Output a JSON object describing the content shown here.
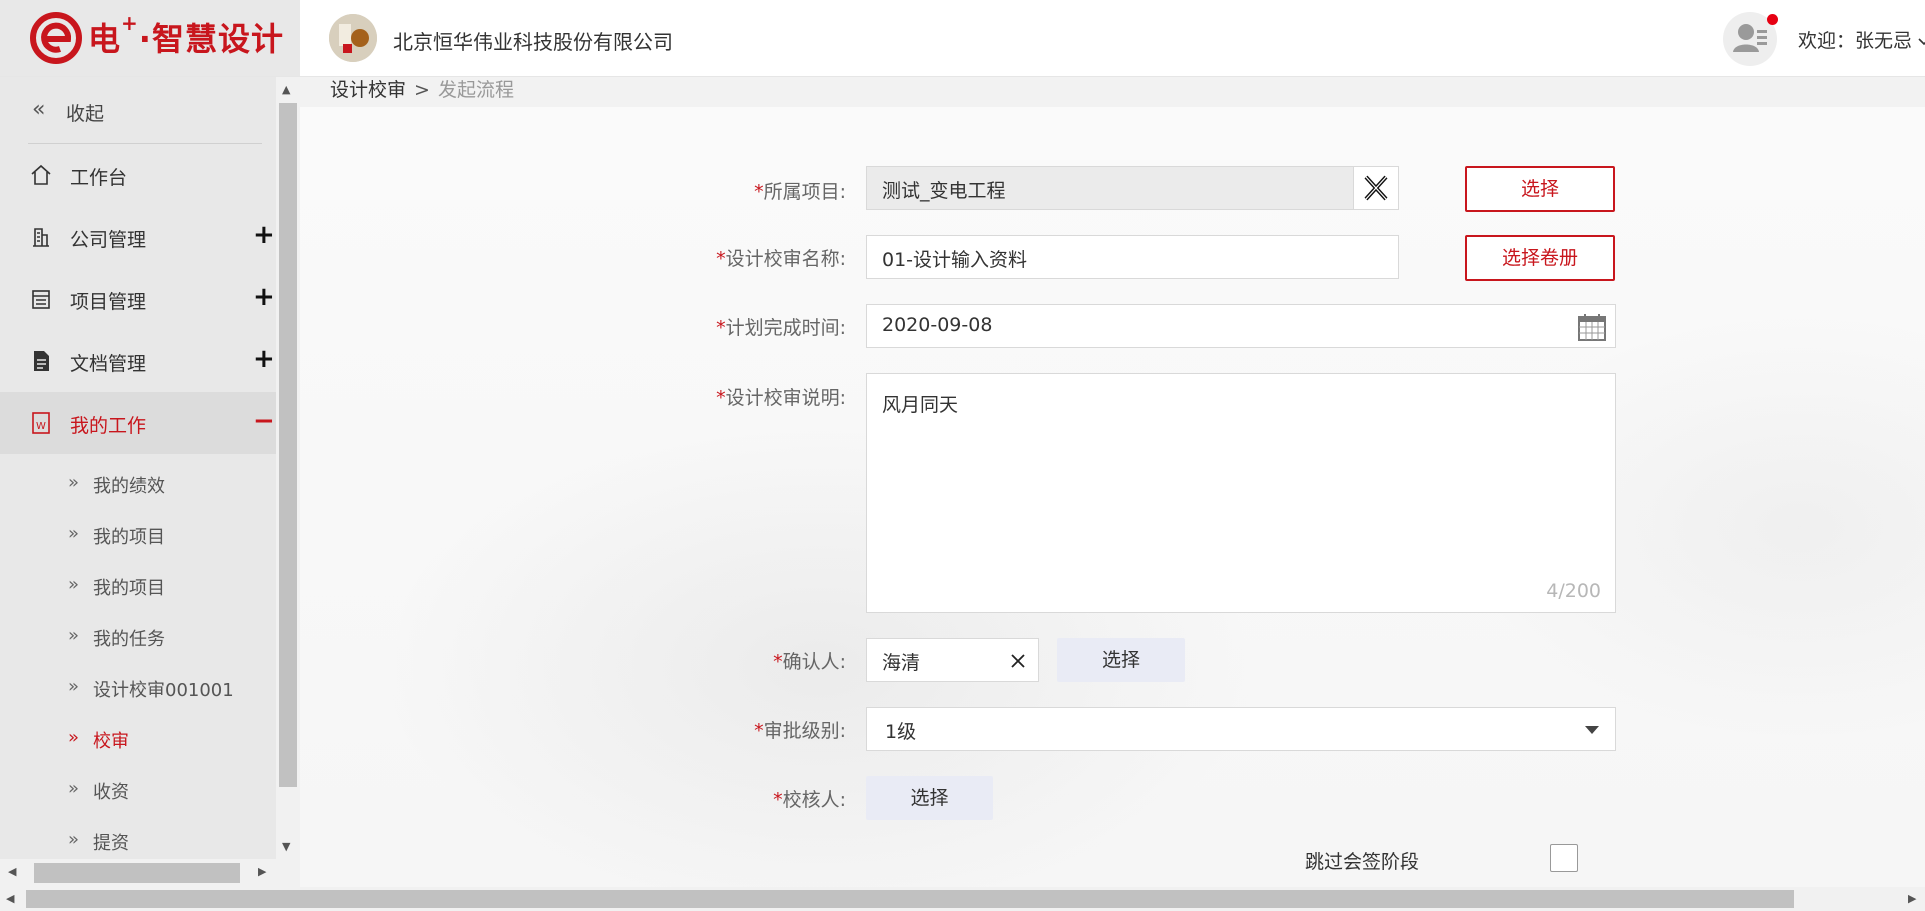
{
  "header": {
    "logo_text": "电",
    "logo_sup": "+",
    "logo_rest": "·智慧设计",
    "company_name": "北京恒华伟业科技股份有限公司",
    "welcome": "欢迎：张无忌"
  },
  "sidebar": {
    "collapse_label": "收起",
    "items": [
      {
        "label": "工作台",
        "icon": "home-icon",
        "toggle": ""
      },
      {
        "label": "公司管理",
        "icon": "building-icon",
        "toggle": "+"
      },
      {
        "label": "项目管理",
        "icon": "calendar-list-icon",
        "toggle": "+"
      },
      {
        "label": "文档管理",
        "icon": "document-icon",
        "toggle": "+"
      },
      {
        "label": "我的工作",
        "icon": "word-doc-icon",
        "toggle": "−"
      }
    ],
    "sub_items": [
      {
        "label": "我的绩效"
      },
      {
        "label": "我的项目"
      },
      {
        "label": "我的项目"
      },
      {
        "label": "我的任务"
      },
      {
        "label": "设计校审001001"
      },
      {
        "label": "校审"
      },
      {
        "label": "收资"
      },
      {
        "label": "提资"
      }
    ],
    "active_sub": "校审"
  },
  "breadcrumb": {
    "level1": "设计校审",
    "separator": ">",
    "level2": "发起流程"
  },
  "form": {
    "project": {
      "label": "所属项目:",
      "required": "*",
      "value": "测试_变电工程",
      "button": "选择"
    },
    "review_name": {
      "label": "设计校审名称:",
      "required": "*",
      "value": "01-设计输入资料",
      "button": "选择卷册"
    },
    "plan_date": {
      "label": "计划完成时间:",
      "required": "*",
      "value": "2020-09-08"
    },
    "description": {
      "label": "设计校审说明:",
      "required": "*",
      "value": "风月同天",
      "counter": "4/200"
    },
    "confirmer": {
      "label": "确认人:",
      "required": "*",
      "value": "海清",
      "button": "选择"
    },
    "approval_level": {
      "label": "审批级别:",
      "required": "*",
      "value": "1级"
    },
    "checker": {
      "label": "校核人:",
      "required": "*",
      "button": "选择"
    },
    "skip_countersign": {
      "label": "跳过会签阶段",
      "checked": false
    }
  },
  "colors": {
    "accent": "#c8161d",
    "sidebar_bg": "#e8e8e8",
    "soft_button": "#e9ebf5"
  }
}
